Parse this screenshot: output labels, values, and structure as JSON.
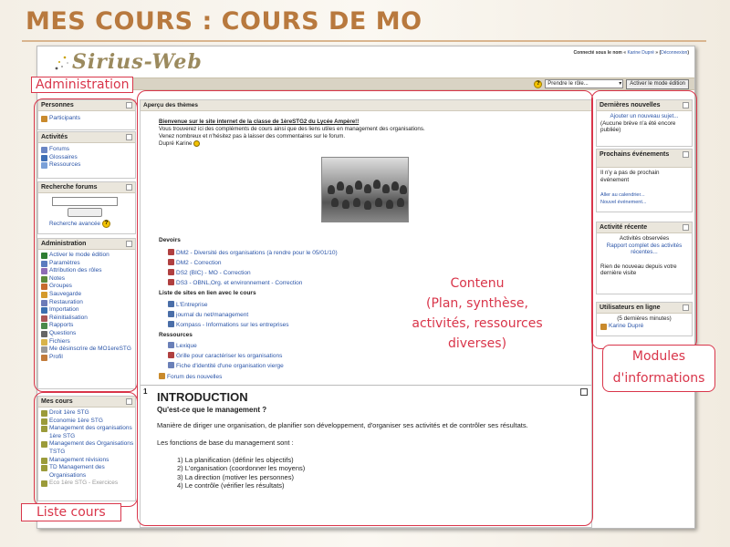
{
  "slide": {
    "title": "MES COURS : COURS DE MO"
  },
  "header": {
    "logo_text": "Sirius-Web",
    "login_prefix": "Connecté sous le nom « ",
    "login_user": "Karine Dupré",
    "login_suffix": " » (",
    "logout": "Déconnexion",
    "logout_end": ")"
  },
  "navbar": {
    "role_select": "Prendre le rôle...",
    "edit_mode_button": "Activer le mode édition"
  },
  "left": {
    "persons": {
      "title": "Personnes",
      "items": [
        "Participants"
      ]
    },
    "activities": {
      "title": "Activités",
      "items": [
        "Forums",
        "Glossaires",
        "Ressources"
      ]
    },
    "search": {
      "title": "Recherche forums",
      "advanced": "Recherche avancée"
    },
    "admin": {
      "title": "Administration",
      "items": [
        "Activer le mode édition",
        "Paramètres",
        "Attribution des rôles",
        "Notes",
        "Groupes",
        "Sauvegarde",
        "Restauration",
        "Importation",
        "Réinitialisation",
        "Rapports",
        "Questions",
        "Fichiers",
        "Me désinscrire de MO1ereSTG",
        "Profil"
      ]
    },
    "courses": {
      "title": "Mes cours",
      "items": [
        "Droit 1ère STG",
        "Economie 1ère STG",
        "Management des organisations 1ère STG",
        "Management des Organisations TSTG",
        "Management révisions",
        "TD Management des Organisations",
        "Eco 1ère STG - Exercices"
      ]
    }
  },
  "center": {
    "header": "Aperçu des thèmes",
    "welcome_title": "Bienvenue sur le site internet de la classe de 1èreSTG2 du Lycée Ampère!!",
    "welcome_line1": "Vous trouverez ici des compléments de cours ainsi que des liens utiles en management des organisations.",
    "welcome_line2": "Venez nombreux et n'hésitez pas à laisser des commentaires sur le forum.",
    "welcome_sign": "Dupré Karine",
    "devoirs_label": "Devoirs",
    "devoirs": [
      "DM2 - Diversité des organisations (à rendre pour le 05/01/10)",
      "DM2 - Correction",
      "DS2 (BIC) - MO - Correction",
      "DS3 - OBNL,Org. et environnement - Correction"
    ],
    "links_label": "Liste de sites en lien avec le cours",
    "links": [
      "L'Entreprise",
      "journal du net/management",
      "Kompass - Informations sur les entreprises"
    ],
    "resources_label": "Ressources",
    "resources": [
      "Lexique",
      "Grille pour caractériser les organisations",
      "Fiche d'identité d'une organisation vierge"
    ],
    "news_forum": "Forum des nouvelles",
    "topic_number": "1",
    "intro_title": "INTRODUCTION",
    "intro_question": "Qu'est-ce que le management ?",
    "intro_def": "Manière de diriger une organisation, de planifier son développement, d'organiser ses activités et de contrôler ses résultats.",
    "intro_funcs": "Les fonctions de base du management sont :",
    "intro_list": [
      "1) La planification (définir les objectifs)",
      "2) L'organisation (coordonner les moyens)",
      "3) La direction (motiver les personnes)",
      "4) Le contrôle (vérifier les résultats)"
    ]
  },
  "right": {
    "news": {
      "title": "Dernières nouvelles",
      "add": "Ajouter un nouveau sujet...",
      "empty": "(Aucune brève n'a été encore publiée)"
    },
    "events": {
      "title": "Prochains événements",
      "empty": "Il n'y a pas de prochain événement",
      "calendar": "Aller au calendrier...",
      "new_event": "Nouvel événement..."
    },
    "activity": {
      "title": "Activité récente",
      "observed": "Activités observées",
      "full_report": "Rapport complet des activités récentes...",
      "nothing": "Rien de nouveau depuis votre dernière visite"
    },
    "online": {
      "title": "Utilisateurs en ligne",
      "minutes": "(5 dernières minutes)",
      "user": "Karine Dupré"
    }
  },
  "annotations": {
    "administration": "Administration",
    "contenu_1": "Contenu",
    "contenu_2": "(Plan, synthèse,",
    "contenu_3": "activités, ressources",
    "contenu_4": "diverses)",
    "modules_1": "Modules",
    "modules_2": "d'informations",
    "liste_cours": "Liste cours"
  }
}
